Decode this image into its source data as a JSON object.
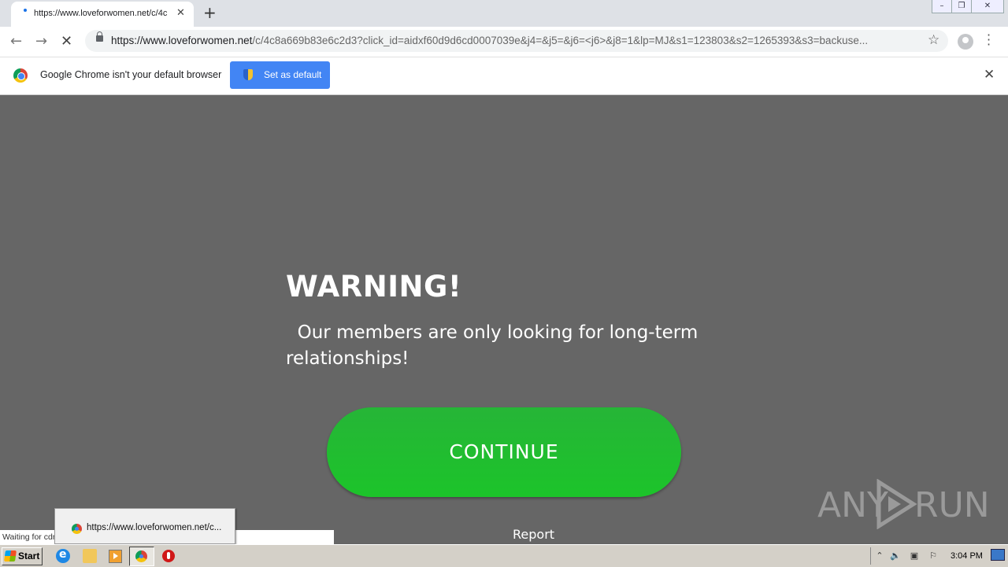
{
  "browser": {
    "tab_title": "https://www.loveforwomen.net/c/4c",
    "url_domain": "https://www.loveforwomen.net",
    "url_path": "/c/4c8a669b83e6c2d3?click_id=aidxf60d9d6cd0007039e&j4=&j5=&j6=<j6>&j8=1&lp=MJ&s1=123803&s2=1265393&s3=backuse...",
    "new_tab_symbol": "+",
    "tab_close_symbol": "✕"
  },
  "infobar": {
    "message": "Google Chrome isn't your default browser",
    "button_label": "Set as default",
    "close_symbol": "✕"
  },
  "page": {
    "heading": "WARNING!",
    "subtext": "  Our members are only looking for long-term relationships!",
    "continue_label": "CONTINUE",
    "report_label": "Report",
    "button_color": "#1fbd2d"
  },
  "status": {
    "text": "Waiting for cdn...",
    "tooltip": "https://www.loveforwomen.net/c..."
  },
  "watermark": {
    "left": "ANY",
    "right": "RUN"
  },
  "taskbar": {
    "start_label": "Start",
    "clock": "3:04 PM"
  },
  "icons": [
    "back-icon",
    "forward-icon",
    "stop-icon",
    "lock-icon",
    "star-icon",
    "profile-icon",
    "menu-icon",
    "chrome-logo-icon",
    "shield-icon",
    "close-icon",
    "ie-icon",
    "explorer-icon",
    "media-player-icon",
    "chrome-icon",
    "opera-icon"
  ]
}
